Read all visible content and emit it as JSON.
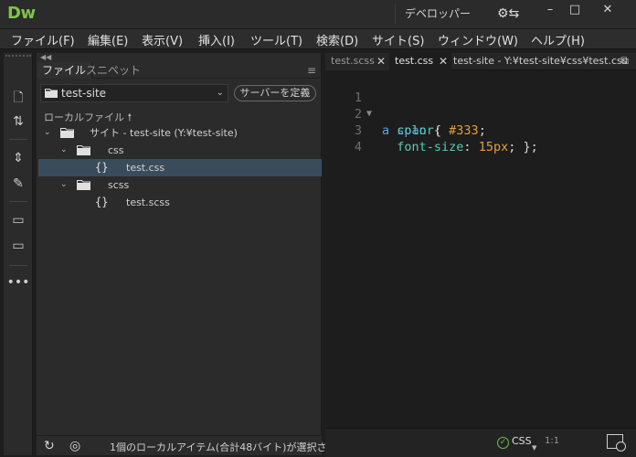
{
  "app": {
    "logo": "Dw",
    "workspace": "デベロッパー",
    "sync_icon": "gear-sync-icon",
    "window_controls": {
      "minimize": "–",
      "maximize": "□",
      "close": "✕"
    }
  },
  "menu": [
    "ファイル(F)",
    "編集(E)",
    "表示(V)",
    "挿入(I)",
    "ツール(T)",
    "検索(D)",
    "サイト(S)",
    "ウィンドウ(W)",
    "ヘルプ(H)"
  ],
  "files_panel": {
    "tabs": [
      "ファイル",
      "スニペット"
    ],
    "site_select": "test-site",
    "define_server": "サーバーを定義",
    "local_files": "ローカルファイル",
    "tree": [
      {
        "label": "サイト - test-site (Y:¥test-site)",
        "type": "folder",
        "level": 0,
        "expanded": true
      },
      {
        "label": "css",
        "type": "folder",
        "level": 1,
        "expanded": true
      },
      {
        "label": "test.css",
        "type": "file",
        "level": 2,
        "selected": true
      },
      {
        "label": "scss",
        "type": "folder",
        "level": 1,
        "expanded": true
      },
      {
        "label": "test.scss",
        "type": "file",
        "level": 2,
        "selected": false
      }
    ],
    "status": "1個のローカルアイテム(合計48バイト)が選択さ..."
  },
  "editor": {
    "tabs": [
      {
        "label": "test.scss",
        "active": false
      },
      {
        "label": "test.css",
        "active": true
      }
    ],
    "path": "test-site - Y:¥test-site¥css¥test.css",
    "lines": [
      {
        "n": "1",
        "selector": "a span",
        "open": " {"
      },
      {
        "n": "2",
        "prop": "color",
        "value": "#333"
      },
      {
        "n": "3",
        "prop": "font-size",
        "value": "15px",
        "close": " }"
      },
      {
        "n": "4"
      }
    ],
    "status": {
      "language": "CSS",
      "position": "1:1"
    }
  },
  "colors": {
    "accent": "#7ec44a",
    "selection": "#3a4b5c",
    "selector": "#5aa0e6",
    "property": "#5cc8b8",
    "value": "#e0a040"
  }
}
